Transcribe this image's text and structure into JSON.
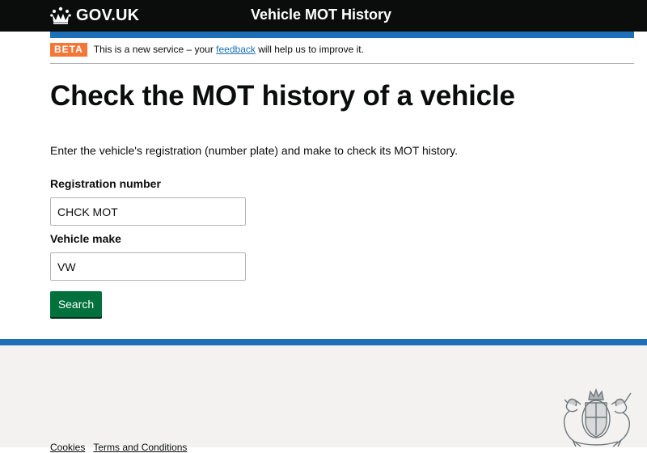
{
  "header": {
    "logo_text": "GOV.UK",
    "service_name": "Vehicle MOT History"
  },
  "phase_banner": {
    "tag": "BETA",
    "text_before": "This is a new service – your ",
    "link_text": "feedback",
    "text_after": " will help us to improve it."
  },
  "main": {
    "title": "Check the MOT history of a vehicle",
    "lead": "Enter the vehicle's registration (number plate) and make to check its MOT history.",
    "registration": {
      "label": "Registration number",
      "value": "CHCK MOT"
    },
    "make": {
      "label": "Vehicle make",
      "value": "VW"
    },
    "submit_label": "Search"
  },
  "footer": {
    "links": [
      "Cookies",
      "Terms and Conditions"
    ]
  },
  "colors": {
    "header_bg": "#0b0c0c",
    "brand_blue": "#1d70b8",
    "beta_orange": "#f47738",
    "button_green": "#00703c",
    "footer_bg": "#f3f2f1",
    "link": "#1d70b8"
  },
  "icons": {
    "logo": "crown-icon",
    "footer": "royal-coat-of-arms-icon"
  }
}
